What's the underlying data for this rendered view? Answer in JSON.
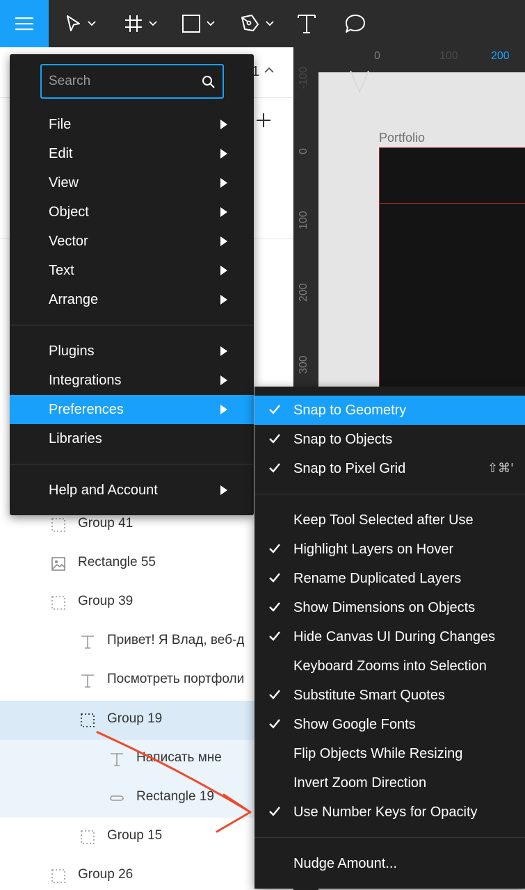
{
  "toolbar": {
    "menu_icon": "hamburger-icon",
    "tools": [
      "move-icon",
      "frame-icon",
      "rectangle-icon",
      "pen-icon",
      "text-icon",
      "comment-icon"
    ],
    "accent": "#18a0fb"
  },
  "pages": {
    "count": "1"
  },
  "canvas": {
    "ruler_top": [
      "0",
      "100",
      "200"
    ],
    "ruler_left": [
      "-100",
      "0",
      "100",
      "200",
      "300"
    ],
    "frame_label": "Portfolio"
  },
  "layers": [
    {
      "name": "Group 41",
      "icon": "group-icon"
    },
    {
      "name": "Rectangle 55",
      "icon": "image-icon"
    },
    {
      "name": "Group 39",
      "icon": "group-icon"
    },
    {
      "name": "Привет! Я Влад, веб-д",
      "icon": "text-icon"
    },
    {
      "name": "Посмотреть портфоли",
      "icon": "text-icon"
    },
    {
      "name": "Group 19",
      "icon": "group-icon"
    },
    {
      "name": "Написать мне",
      "icon": "text-icon"
    },
    {
      "name": "Rectangle 19",
      "icon": "rectangle-icon"
    },
    {
      "name": "Group 15",
      "icon": "group-icon"
    },
    {
      "name": "Group 26",
      "icon": "group-icon"
    }
  ],
  "menu": {
    "search_placeholder": "Search",
    "items": [
      {
        "label": "File"
      },
      {
        "label": "Edit"
      },
      {
        "label": "View"
      },
      {
        "label": "Object"
      },
      {
        "label": "Vector"
      },
      {
        "label": "Text"
      },
      {
        "label": "Arrange"
      },
      {
        "label": "Plugins"
      },
      {
        "label": "Integrations"
      },
      {
        "label": "Preferences"
      },
      {
        "label": "Libraries"
      },
      {
        "label": "Help and Account"
      }
    ]
  },
  "preferences": {
    "items": [
      {
        "label": "Snap to Geometry",
        "checked": true
      },
      {
        "label": "Snap to Objects",
        "checked": true
      },
      {
        "label": "Snap to Pixel Grid",
        "checked": true,
        "shortcut": "⇧⌘'"
      },
      {
        "label": "Keep Tool Selected after Use",
        "checked": false
      },
      {
        "label": "Highlight Layers on Hover",
        "checked": true
      },
      {
        "label": "Rename Duplicated Layers",
        "checked": true
      },
      {
        "label": "Show Dimensions on Objects",
        "checked": true
      },
      {
        "label": "Hide Canvas UI During Changes",
        "checked": true
      },
      {
        "label": "Keyboard Zooms into Selection",
        "checked": false
      },
      {
        "label": "Substitute Smart Quotes",
        "checked": true
      },
      {
        "label": "Show Google Fonts",
        "checked": true
      },
      {
        "label": "Flip Objects While Resizing",
        "checked": false
      },
      {
        "label": "Invert Zoom Direction",
        "checked": false
      },
      {
        "label": "Use Number Keys for Opacity",
        "checked": true
      },
      {
        "label": "Nudge Amount...",
        "checked": false
      }
    ]
  },
  "annotation": {
    "color": "#ef4a2b"
  }
}
